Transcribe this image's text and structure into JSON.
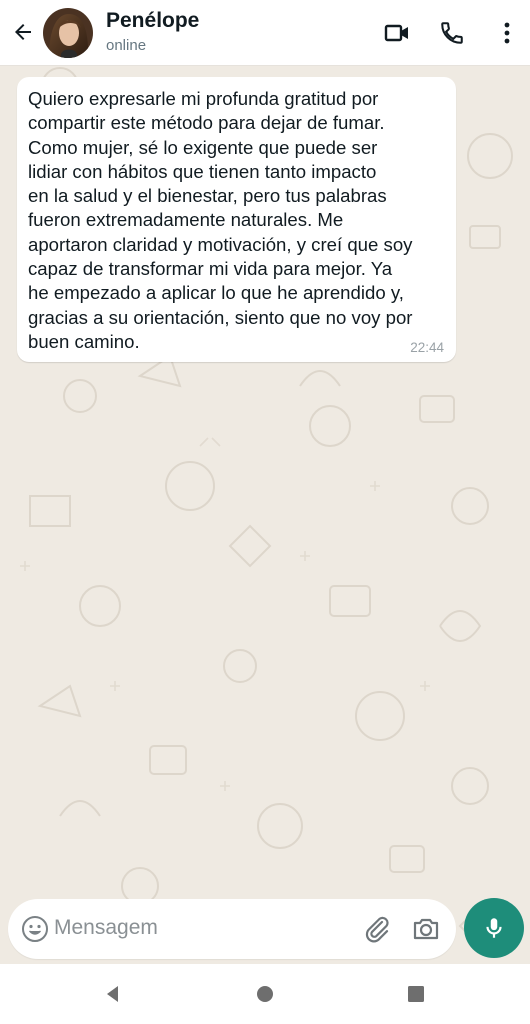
{
  "header": {
    "contact_name": "Penélope",
    "contact_status": "online",
    "back_icon": "arrow-left-icon",
    "video_icon": "video-camera-icon",
    "call_icon": "phone-icon",
    "menu_icon": "more-vertical-icon"
  },
  "messages": [
    {
      "text": "Quiero expresarle mi profunda gratitud por\ncompartir este método para dejar de fumar.\nComo mujer, sé lo exigente que puede ser\nlidiar con hábitos que tienen tanto impacto\nen la salud y el bienestar, pero tus palabras\nfueron extremadamente naturales. Me\naportaron claridad y motivación, y creí que soy\ncapaz de transformar mi vida para mejor. Ya\nhe empezado a aplicar lo que he aprendido y,\ngracias a su orientación, siento que no voy por\nbuen camino.",
      "time": "22:44",
      "direction": "incoming"
    }
  ],
  "composer": {
    "placeholder": "Mensagem",
    "emoji_icon": "emoji-icon",
    "attach_icon": "paperclip-icon",
    "camera_icon": "camera-icon",
    "mic_icon": "microphone-icon"
  },
  "navbar": {
    "back_icon": "triangle-back-icon",
    "home_icon": "circle-home-icon",
    "recents_icon": "square-recents-icon"
  },
  "colors": {
    "chat_bg": "#efeae2",
    "bubble_bg": "#ffffff",
    "accent": "#1e8d7a",
    "text": "#111b21",
    "muted": "#667781"
  }
}
